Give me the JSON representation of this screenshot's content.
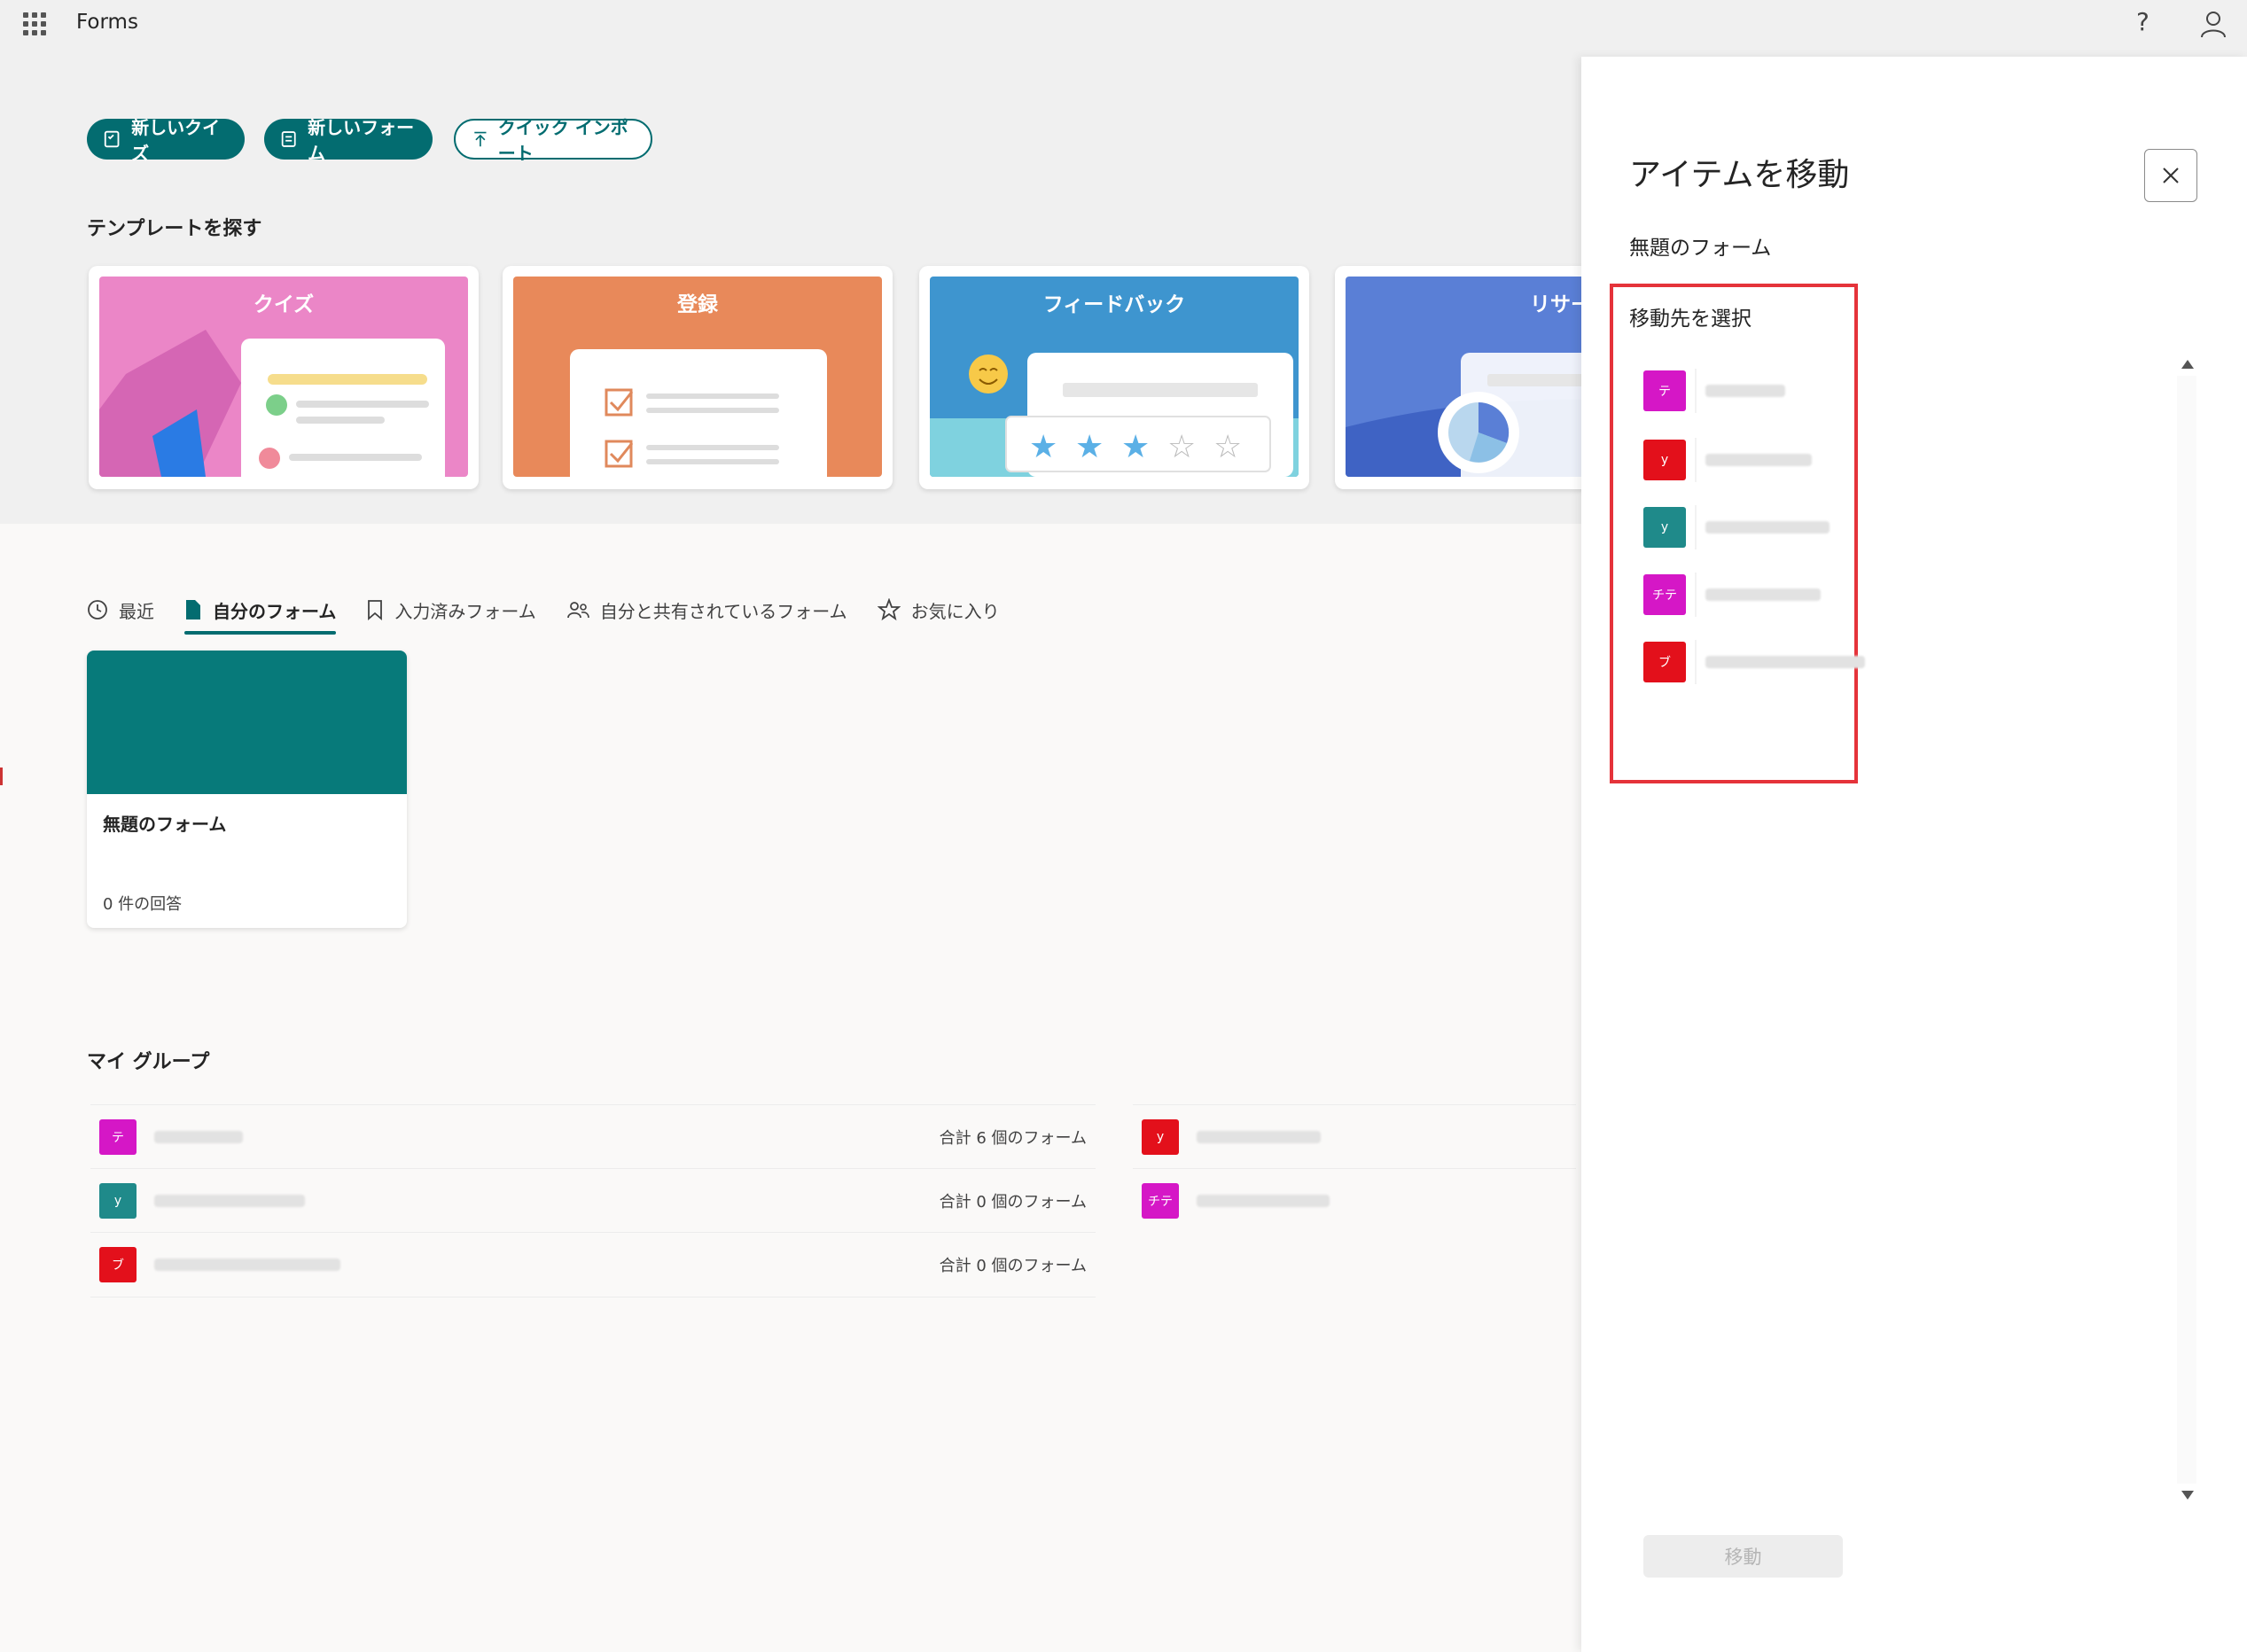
{
  "app": {
    "name": "Forms"
  },
  "header": {
    "help_glyph": "?"
  },
  "actions": {
    "new_quiz": "新しいクイズ",
    "new_form": "新しいフォーム",
    "quick_import": "クイック インポート"
  },
  "templates": {
    "title": "テンプレートを探す",
    "items": [
      {
        "label": "クイズ",
        "color": "#e57bc3"
      },
      {
        "label": "登録",
        "color": "#e8895a"
      },
      {
        "label": "フィードバック",
        "color": "#3e95cf"
      },
      {
        "label": "リサーチ",
        "color": "#5a7fd6"
      }
    ]
  },
  "tabs": [
    {
      "label": "最近",
      "icon": "clock-icon"
    },
    {
      "label": "自分のフォーム",
      "icon": "document-icon",
      "active": true
    },
    {
      "label": "入力済みフォーム",
      "icon": "bookmark-icon"
    },
    {
      "label": "自分と共有されているフォーム",
      "icon": "people-icon"
    },
    {
      "label": "お気に入り",
      "icon": "star-icon"
    }
  ],
  "form_card": {
    "title": "無題のフォーム",
    "responses": "0 件の回答",
    "banner_color": "#077a7a"
  },
  "groups": {
    "title": "マイ グループ",
    "left": [
      {
        "avatar": "テ",
        "color": "#d517c6",
        "count": "合計 6 個のフォーム"
      },
      {
        "avatar": "y",
        "color": "#1f8a8a",
        "count": "合計 0 個のフォーム"
      },
      {
        "avatar": "ブ",
        "color": "#e3101b",
        "count": "合計 0 個のフォーム"
      }
    ],
    "right": [
      {
        "avatar": "y",
        "color": "#e3101b"
      },
      {
        "avatar": "チテ",
        "color": "#d517c6"
      }
    ]
  },
  "panel": {
    "title": "アイテムを移動",
    "item_name": "無題のフォーム",
    "destination_label": "移動先を選択",
    "destinations": [
      {
        "avatar": "テ",
        "color": "#d517c6"
      },
      {
        "avatar": "y",
        "color": "#e3101b"
      },
      {
        "avatar": "y",
        "color": "#1f8a8a"
      },
      {
        "avatar": "チテ",
        "color": "#d517c6"
      },
      {
        "avatar": "ブ",
        "color": "#e3101b"
      }
    ],
    "move_button": "移動"
  },
  "colors": {
    "accent": "#036c70",
    "highlight": "#e5333a"
  }
}
